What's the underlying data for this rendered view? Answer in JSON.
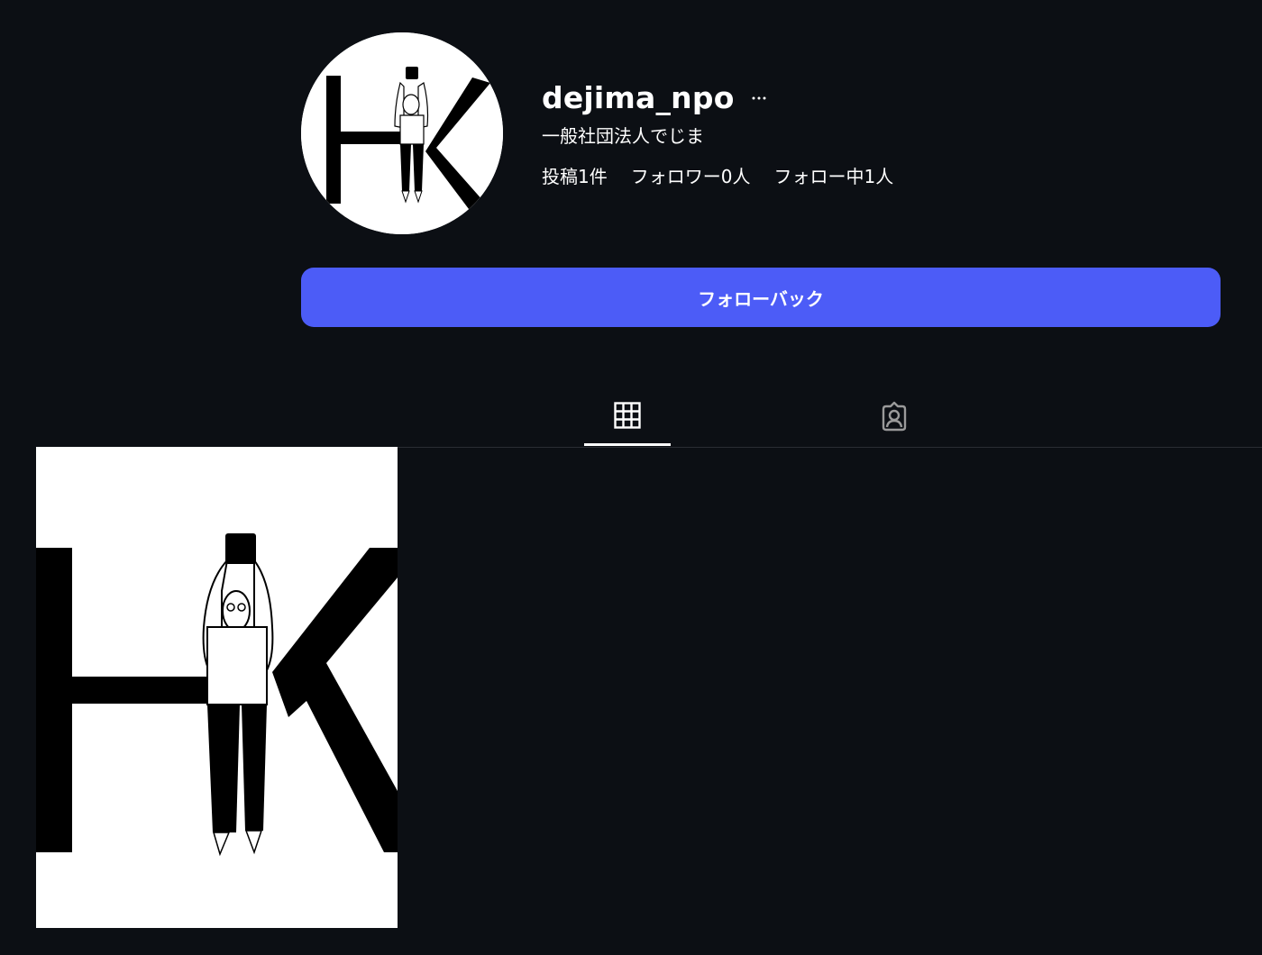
{
  "profile": {
    "username": "dejima_npo",
    "display_name": "一般社団法人でじま",
    "avatar_icon": "hk-logo-avatar",
    "more_icon": "more-horizontal-icon"
  },
  "stats": {
    "posts_label": "投稿1件",
    "followers_label": "フォロワー0人",
    "following_label": "フォロー中1人"
  },
  "follow_button": {
    "label": "フォローバック",
    "color": "#4c5cf7"
  },
  "tabs": [
    {
      "icon": "grid-icon",
      "active": true
    },
    {
      "icon": "tagged-person-icon",
      "active": false
    }
  ],
  "posts": [
    {
      "thumbnail_icon": "hk-logo-illustration"
    }
  ],
  "colors": {
    "background": "#0c0f14",
    "text": "#ffffff",
    "accent": "#4c5cf7",
    "divider": "#2a2d33"
  }
}
